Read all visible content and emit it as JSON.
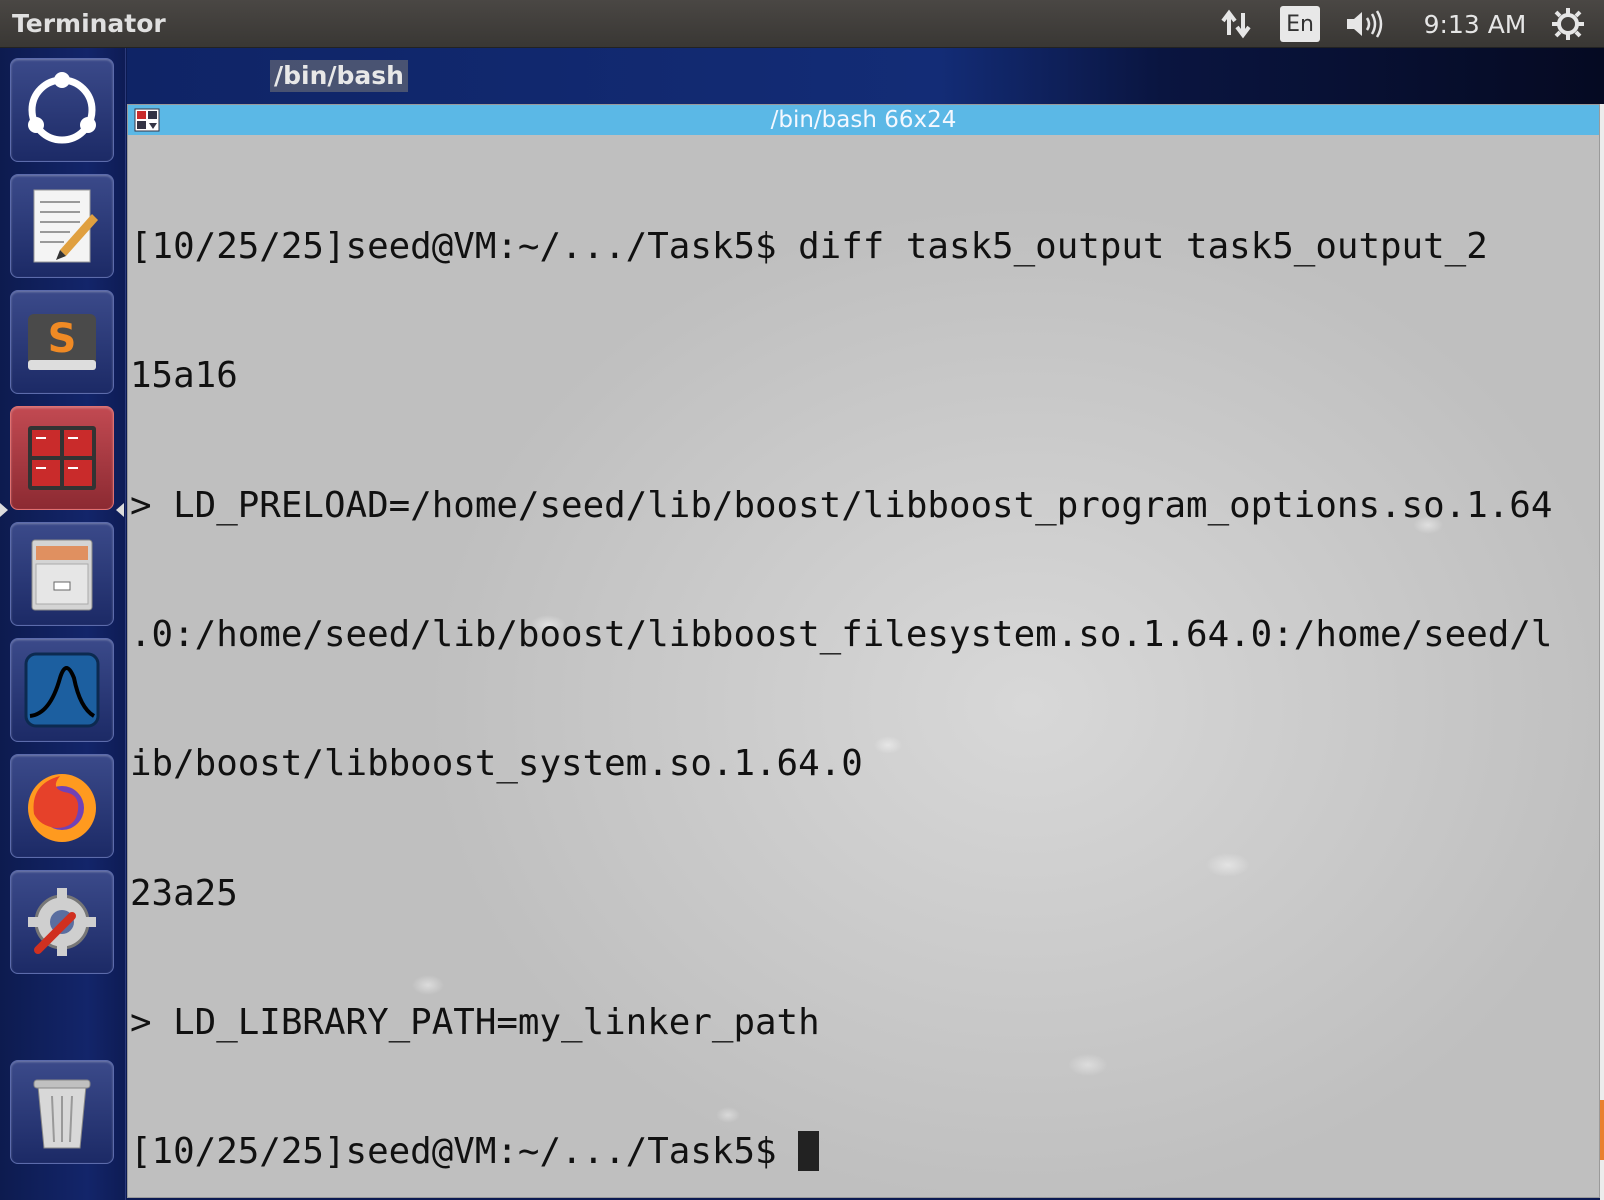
{
  "top_panel": {
    "app_title": "Terminator",
    "lang": "En",
    "clock": "9:13 AM",
    "icons": [
      "network-icon",
      "volume-icon",
      "power-icon"
    ]
  },
  "launcher": {
    "items": [
      "ubuntu-dash-icon",
      "text-editor-icon",
      "sublime-text-icon",
      "terminator-icon",
      "file-manager-icon",
      "wireshark-icon",
      "firefox-icon",
      "system-settings-icon",
      "trash-icon"
    ],
    "active": "terminator-icon"
  },
  "tab": {
    "title": "/bin/bash"
  },
  "terminal": {
    "title": "/bin/bash 66x24",
    "lines": [
      "[10/25/25]seed@VM:~/.../Task5$ diff task5_output task5_output_2",
      "15a16",
      "> LD_PRELOAD=/home/seed/lib/boost/libboost_program_options.so.1.64",
      ".0:/home/seed/lib/boost/libboost_filesystem.so.1.64.0:/home/seed/l",
      "ib/boost/libboost_system.so.1.64.0",
      "23a25",
      "> LD_LIBRARY_PATH=my_linker_path"
    ],
    "prompt": "[10/25/25]seed@VM:~/.../Task5$ "
  },
  "colors": {
    "titlebar": "#5bb8e6",
    "launcher_bg": "#13256a",
    "active_launcher": "#c24a52"
  }
}
